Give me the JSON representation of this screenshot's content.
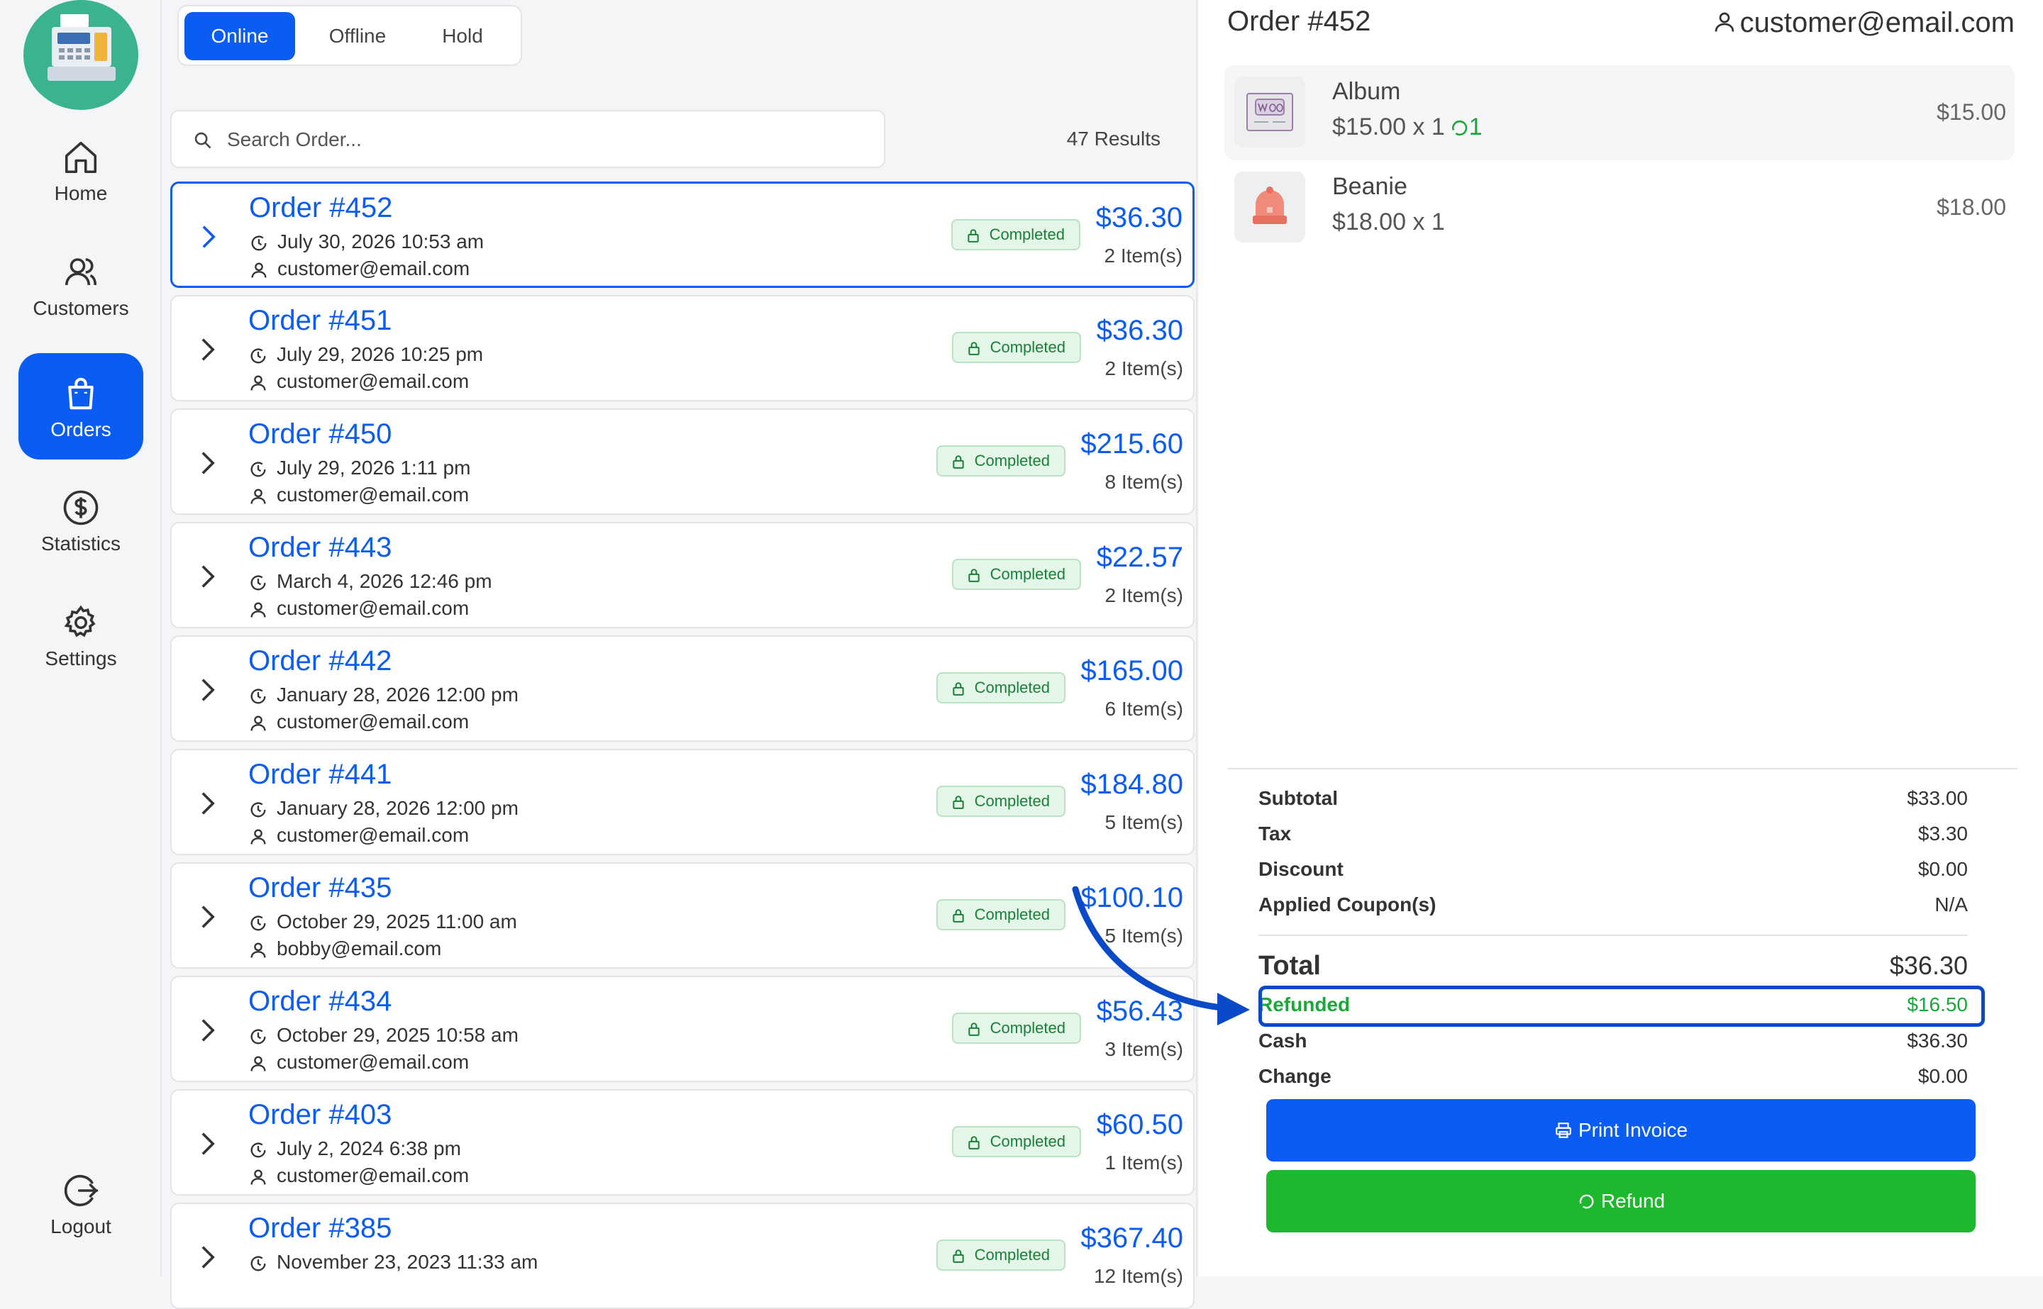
{
  "sidebar": {
    "items": [
      {
        "label": "Home",
        "icon": "home-icon"
      },
      {
        "label": "Customers",
        "icon": "customers-icon"
      },
      {
        "label": "Orders",
        "icon": "bag-icon"
      },
      {
        "label": "Statistics",
        "icon": "dollar-icon"
      },
      {
        "label": "Settings",
        "icon": "gear-icon"
      }
    ],
    "logout": "Logout",
    "active": "Orders"
  },
  "tabs": [
    "Online",
    "Offline",
    "Hold"
  ],
  "search": {
    "placeholder": "Search Order..."
  },
  "results": "47 Results",
  "orders": [
    {
      "number": "Order #452",
      "date": "July 30, 2026 10:53 am",
      "email": "customer@email.com",
      "status": "Completed",
      "amount": "$36.30",
      "items": "2 Item(s)"
    },
    {
      "number": "Order #451",
      "date": "July 29, 2026 10:25 pm",
      "email": "customer@email.com",
      "status": "Completed",
      "amount": "$36.30",
      "items": "2 Item(s)"
    },
    {
      "number": "Order #450",
      "date": "July 29, 2026 1:11 pm",
      "email": "customer@email.com",
      "status": "Completed",
      "amount": "$215.60",
      "items": "8 Item(s)"
    },
    {
      "number": "Order #443",
      "date": "March 4, 2026 12:46 pm",
      "email": "customer@email.com",
      "status": "Completed",
      "amount": "$22.57",
      "items": "2 Item(s)"
    },
    {
      "number": "Order #442",
      "date": "January 28, 2026 12:00 pm",
      "email": "customer@email.com",
      "status": "Completed",
      "amount": "$165.00",
      "items": "6 Item(s)"
    },
    {
      "number": "Order #441",
      "date": "January 28, 2026 12:00 pm",
      "email": "customer@email.com",
      "status": "Completed",
      "amount": "$184.80",
      "items": "5 Item(s)"
    },
    {
      "number": "Order #435",
      "date": "October 29, 2025 11:00 am",
      "email": "bobby@email.com",
      "status": "Completed",
      "amount": "$100.10",
      "items": "5 Item(s)"
    },
    {
      "number": "Order #434",
      "date": "October 29, 2025 10:58 am",
      "email": "customer@email.com",
      "status": "Completed",
      "amount": "$56.43",
      "items": "3 Item(s)"
    },
    {
      "number": "Order #403",
      "date": "July 2, 2024 6:38 pm",
      "email": "customer@email.com",
      "status": "Completed",
      "amount": "$60.50",
      "items": "1 Item(s)"
    },
    {
      "number": "Order #385",
      "date": "November 23, 2023 11:33 am",
      "email": "",
      "status": "Completed",
      "amount": "$367.40",
      "items": "12 Item(s)"
    }
  ],
  "detail": {
    "title": "Order #452",
    "customer": "customer@email.com",
    "line_items": [
      {
        "name": "Album",
        "qty": "$15.00 x 1",
        "refund": "1",
        "price": "$15.00"
      },
      {
        "name": "Beanie",
        "qty": "$18.00 x 1",
        "refund": "",
        "price": "$18.00"
      }
    ],
    "totals": {
      "subtotal_label": "Subtotal",
      "subtotal": "$33.00",
      "tax_label": "Tax",
      "tax": "$3.30",
      "discount_label": "Discount",
      "discount": "$0.00",
      "coupon_label": "Applied Coupon(s)",
      "coupon": "N/A",
      "total_label": "Total",
      "total": "$36.30",
      "refunded_label": "Refunded",
      "refunded": "$16.50",
      "cash_label": "Cash",
      "cash": "$36.30",
      "change_label": "Change",
      "change": "$0.00"
    },
    "print_label": "Print Invoice",
    "refund_label": "Refund"
  },
  "colors": {
    "accent": "#0a5cf2",
    "success": "#1db82d",
    "refunded": "#1aa838"
  }
}
